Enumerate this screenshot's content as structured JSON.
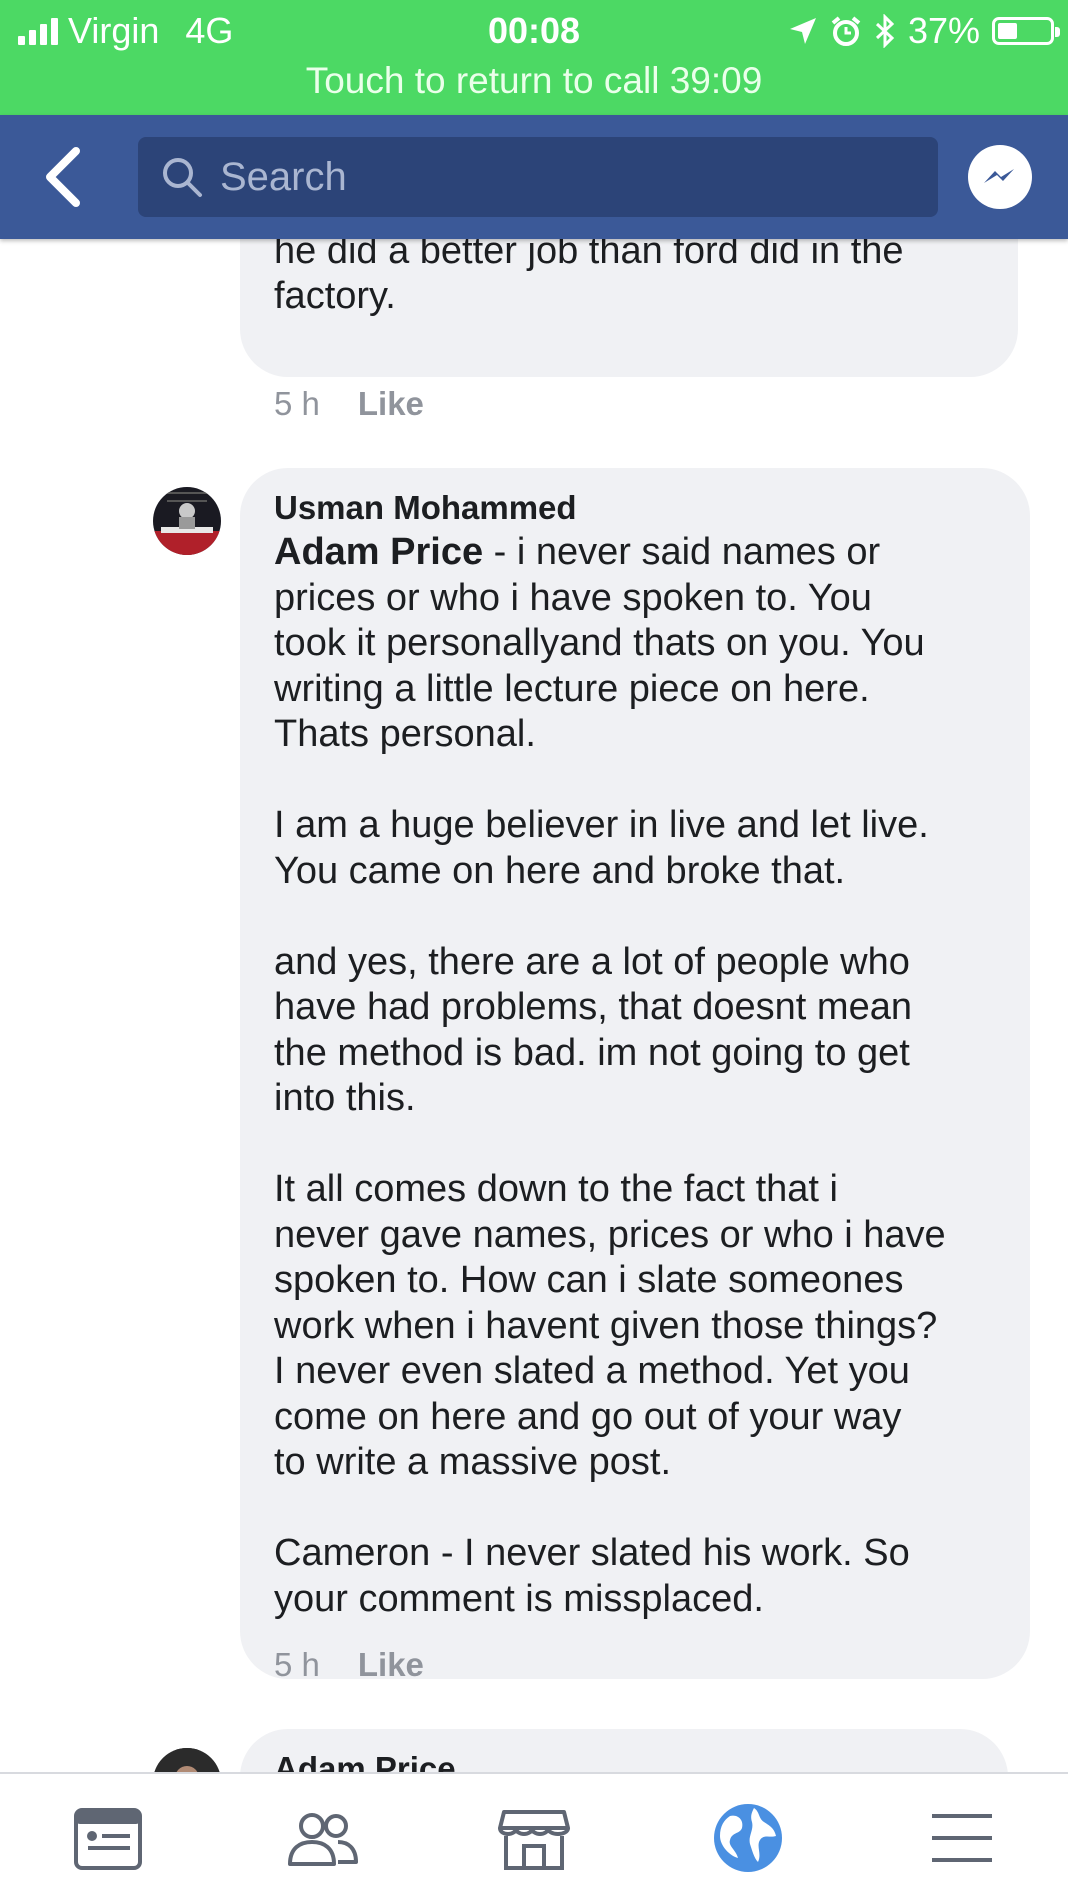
{
  "status_bar": {
    "carrier": "Virgin",
    "network": "4G",
    "time": "00:08",
    "battery_percent": "37%",
    "battery_level": 0.37,
    "call_banner": "Touch to return to call 39:09"
  },
  "nav": {
    "search_placeholder": "Search"
  },
  "comments": [
    {
      "text": "Adam completely sorted it out. I think\nhe did a better job than ford did in the\nfactory.",
      "time": "5 h",
      "like": "Like"
    },
    {
      "author": "Usman Mohammed",
      "mention": "Adam Price",
      "text": " - i never said names or\nprices or who i have spoken to. You\ntook it personallyand thats on you. You\nwriting a little lecture piece on here.\nThats personal.\n\nI am a huge believer in live and let live.\nYou came on here and broke that.\n\nand yes, there are a lot of people who\nhave had problems, that doesnt mean\nthe method is bad. im not going to get\ninto this.\n\nIt all comes down to the fact that i\nnever gave names, prices or who i have\nspoken to. How can i slate someones\nwork when i havent given those things?\nI never even slated a method. Yet you\ncome on here and go out of your way\nto write a massive post.\n\nCameron - I never slated his work. So\nyour comment is missplaced.",
      "time": "5 h",
      "like": "Like"
    },
    {
      "author": "Adam Price"
    }
  ],
  "tabs": [
    {
      "name": "news-feed-icon"
    },
    {
      "name": "friends-icon"
    },
    {
      "name": "marketplace-icon"
    },
    {
      "name": "notifications-globe-icon"
    },
    {
      "name": "menu-icon"
    }
  ],
  "colors": {
    "status_bar": "#4cd964",
    "nav_bar": "#3b5998",
    "search_box": "#2c4478",
    "bubble": "#f0f1f4",
    "meta_text": "#90949c",
    "active_tab": "#4a90e2"
  }
}
